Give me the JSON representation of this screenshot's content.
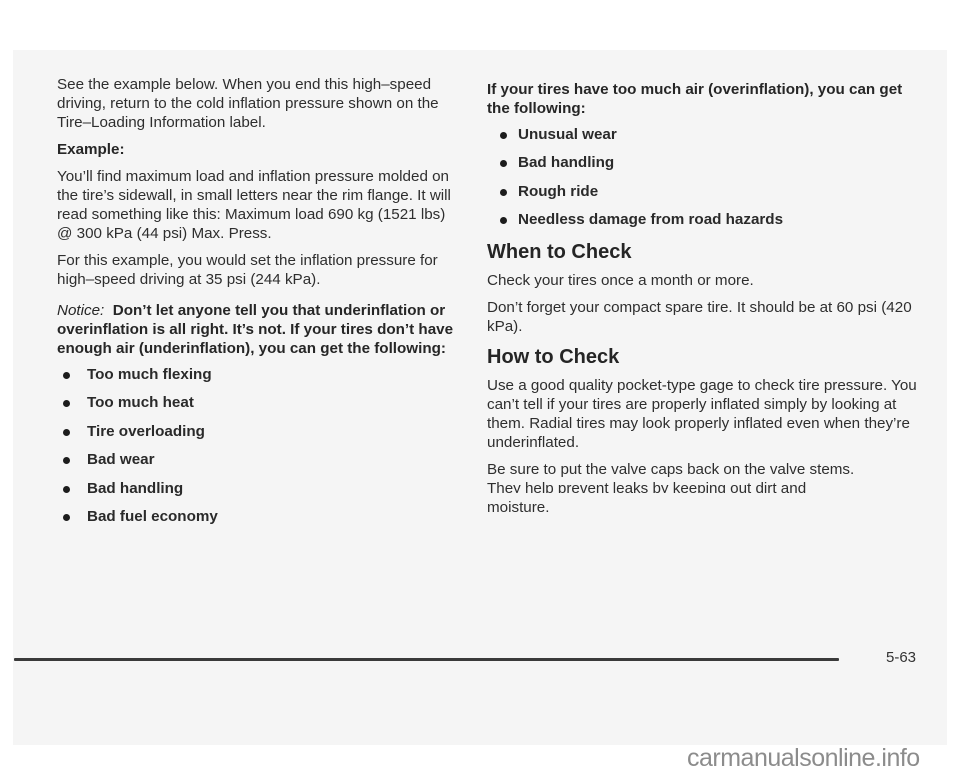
{
  "left_column": {
    "intro_paragraph": "See the example below. When you end this high–speed driving, return to the cold inflation pressure shown on the Tire–Loading Information label.",
    "example_label": "Example:",
    "example_paragraph": "You’ll find maximum load and inflation pressure molded on the tire’s sidewall, in small letters near the rim flange. It will read something like this: Maximum load 690 kg (1521 lbs) @ 300 kPa (44 psi) Max. Press.",
    "example_setting": "For this example, you would set the inflation pressure for high–speed driving at 35 psi (244 kPa).",
    "notice_label": "Notice:",
    "notice_text": "Don’t let anyone tell you that underinflation or overinflation is all right. It’s not. If your tires don’t have enough air (underinflation), you can get the following:",
    "underinflation_effects": [
      "Too much flexing",
      "Too much heat",
      "Tire overloading",
      "Bad wear",
      "Bad handling",
      "Bad fuel economy"
    ]
  },
  "right_column": {
    "overinflation_intro": "If your tires have too much air (overinflation), you can get the following:",
    "overinflation_effects": [
      "Unusual wear",
      "Bad handling",
      "Rough ride",
      "Needless damage from road hazards"
    ],
    "when_to_check": {
      "heading": "When to Check",
      "paragraphs": [
        "Check your tires once a month or more.",
        "Don’t forget your compact spare tire. It should be at 60 psi (420 kPa)."
      ]
    },
    "how_to_check": {
      "heading": "How to Check",
      "paragraphs": [
        "Use a good quality pocket-type gage to check tire pressure. You can’t tell if your tires are properly inflated simply by looking at them. Radial tires may look properly inflated even when they’re underinflated."
      ],
      "valve_caps_line1": "Be sure to put the valve caps back on the valve stems.",
      "valve_caps_line2": "They help prevent leaks by keeping out dirt and",
      "valve_caps_line3": "moisture."
    }
  },
  "footer": {
    "page_number": "5-63"
  },
  "watermark": "carmanualsonline.info"
}
